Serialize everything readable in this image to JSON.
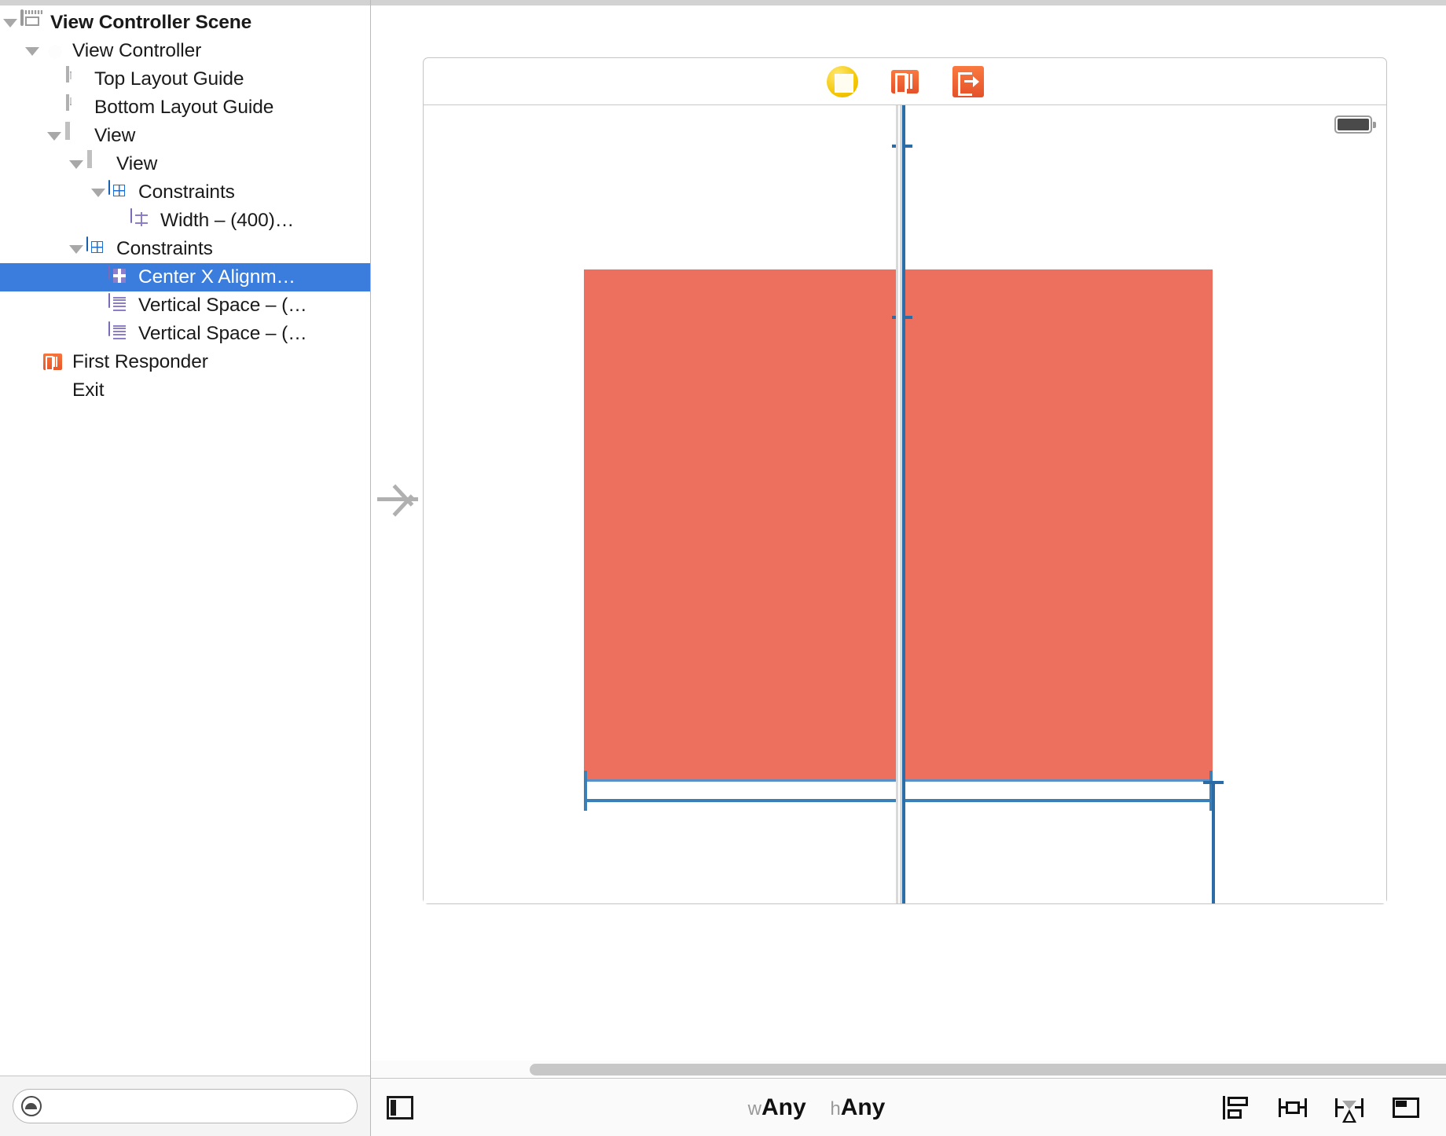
{
  "outline": {
    "rows": [
      {
        "label": "View Controller Scene",
        "icon": "scene-icon",
        "indent": 0,
        "twisty": true,
        "bold": true,
        "selected": false
      },
      {
        "label": "View Controller",
        "icon": "view-controller-icon",
        "indent": 1,
        "twisty": true,
        "bold": false,
        "selected": false
      },
      {
        "label": "Top Layout Guide",
        "icon": "top-layout-guide-icon",
        "indent": 2,
        "twisty": false,
        "bold": false,
        "selected": false
      },
      {
        "label": "Bottom Layout Guide",
        "icon": "bottom-layout-guide-icon",
        "indent": 2,
        "twisty": false,
        "bold": false,
        "selected": false
      },
      {
        "label": "View",
        "icon": "view-icon",
        "indent": 2,
        "twisty": true,
        "bold": false,
        "selected": false
      },
      {
        "label": "View",
        "icon": "view-icon",
        "indent": 3,
        "twisty": true,
        "bold": false,
        "selected": false
      },
      {
        "label": "Constraints",
        "icon": "constraints-icon",
        "indent": 4,
        "twisty": true,
        "bold": false,
        "selected": false
      },
      {
        "label": "Width – (400)…",
        "icon": "width-constraint-icon",
        "indent": 5,
        "twisty": false,
        "bold": false,
        "selected": false
      },
      {
        "label": "Constraints",
        "icon": "constraints-icon",
        "indent": 3,
        "twisty": true,
        "bold": false,
        "selected": false
      },
      {
        "label": "Center X Alignm…",
        "icon": "center-x-alignment-icon",
        "indent": 4,
        "twisty": false,
        "bold": false,
        "selected": true
      },
      {
        "label": "Vertical Space – (…",
        "icon": "vertical-space-constraint-icon",
        "indent": 4,
        "twisty": false,
        "bold": false,
        "selected": false
      },
      {
        "label": "Vertical Space – (…",
        "icon": "vertical-space-constraint-icon",
        "indent": 4,
        "twisty": false,
        "bold": false,
        "selected": false
      },
      {
        "label": "First Responder",
        "icon": "first-responder-icon",
        "indent": 1,
        "twisty": false,
        "bold": false,
        "selected": false
      },
      {
        "label": "Exit",
        "icon": "exit-icon",
        "indent": 1,
        "twisty": false,
        "bold": false,
        "selected": false
      }
    ],
    "filter": {
      "placeholder": "",
      "value": "",
      "icon": "filter-icon"
    }
  },
  "canvas": {
    "dock_icons": [
      {
        "name": "view-controller-dock-icon",
        "kind": "view-controller"
      },
      {
        "name": "first-responder-dock-icon",
        "kind": "first-responder"
      },
      {
        "name": "exit-dock-icon",
        "kind": "exit"
      }
    ],
    "status_bar": {
      "battery_icon": "battery-icon"
    },
    "subview": {
      "name": "red-subview",
      "fill_color": "#ED6F5E"
    },
    "entry_point": {
      "icon": "storyboard-entry-point-arrow"
    },
    "selected_constraint_color": "#2C6FA8",
    "constraint_color": "#3A7FB5"
  },
  "bottom_bar": {
    "dock_toggle_icon": "show-document-outline-icon",
    "size_class": {
      "width_prefix": "w",
      "width_value": "Any",
      "height_prefix": "h",
      "height_value": "Any"
    },
    "autolayout_tools": [
      {
        "label": "Align",
        "icon": "align-icon"
      },
      {
        "label": "Pin",
        "icon": "pin-icon"
      },
      {
        "label": "Resolve Auto Layout Issues",
        "icon": "resolve-issues-icon"
      },
      {
        "label": "Stack / Embed",
        "icon": "stack-embed-icon"
      }
    ]
  }
}
